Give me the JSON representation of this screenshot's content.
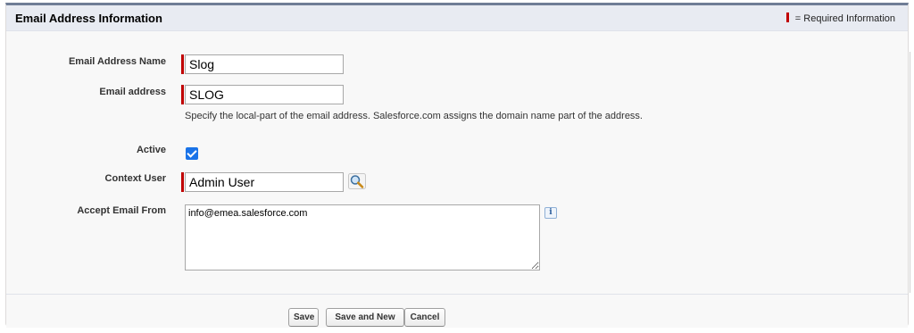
{
  "section": {
    "title": "Email Address Information",
    "required_legend": "= Required Information"
  },
  "fields": {
    "email_address_name": {
      "label": "Email Address Name",
      "value": "Slog"
    },
    "email_address": {
      "label": "Email address",
      "value": "SLOG",
      "help_text": "Specify the local-part of the email address. Salesforce.com assigns the domain name part of the address."
    },
    "active": {
      "label": "Active",
      "checked": true
    },
    "context_user": {
      "label": "Context User",
      "value": "Admin User",
      "lookup_icon": "magnifier-lookup-icon"
    },
    "accept_email_from": {
      "label": "Accept Email From",
      "value": "info@emea.salesforce.com",
      "info_icon_glyph": "i"
    }
  },
  "buttons": {
    "save": "Save",
    "save_and_new": "Save and New",
    "cancel": "Cancel"
  },
  "colors": {
    "required": "#c00000",
    "checkbox": "#1a73e8",
    "header_bg": "#e8ebf2",
    "header_border": "#6f7d96"
  }
}
